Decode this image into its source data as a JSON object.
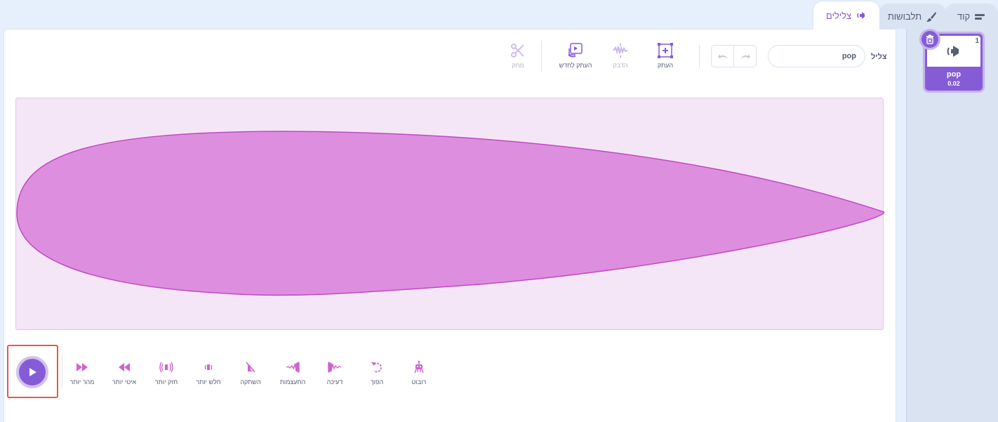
{
  "tabs": [
    {
      "label": "קוד",
      "icon": "code-icon"
    },
    {
      "label": "תלבושות",
      "icon": "brush-icon"
    },
    {
      "label": "צלילים",
      "icon": "sound-icon",
      "active": true
    }
  ],
  "sound_list": {
    "items": [
      {
        "index": "1",
        "name": "pop",
        "duration": "0.02"
      }
    ]
  },
  "editor": {
    "sound_label": "צליל",
    "sound_name_value": "pop",
    "undo_icon": "undo-icon",
    "redo_icon": "redo-icon",
    "tools": {
      "copy": "העתק",
      "paste": "הדבק",
      "copy_to_new": "העתק לחדש",
      "delete": "מחק"
    }
  },
  "effects": {
    "faster": "מהר יותר",
    "slower": "איטי יותר",
    "louder": "חזק יותר",
    "softer": "חלש יותר",
    "mute": "השתקה",
    "fade_in": "התעצמות",
    "fade_out": "דעיכה",
    "reverse": "הפוך",
    "robot": "רובוט"
  },
  "colors": {
    "accent": "#855cd6",
    "waveform_fill": "#de8edf",
    "waveform_stroke": "#c049c3",
    "waveform_bg": "#f5e6f7",
    "effect_icon": "#cf63cf",
    "highlight": "#e55a45"
  }
}
